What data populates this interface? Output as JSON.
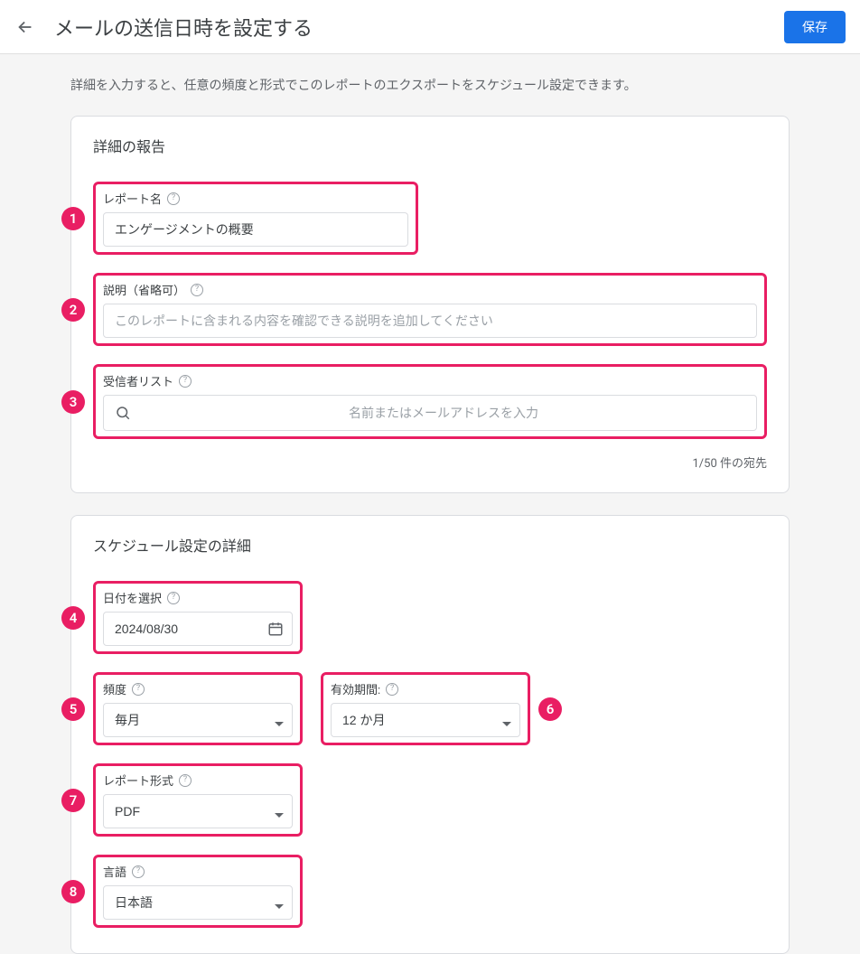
{
  "header": {
    "title": "メールの送信日時を設定する",
    "save_label": "保存"
  },
  "description": "詳細を入力すると、任意の頻度と形式でこのレポートのエクスポートをスケジュール設定できます。",
  "report_details": {
    "card_title": "詳細の報告",
    "name_label": "レポート名",
    "name_value": "エンゲージメントの概要",
    "desc_label": "説明（省略可）",
    "desc_placeholder": "このレポートに含まれる内容を確認できる説明を追加してください",
    "recipients_label": "受信者リスト",
    "recipients_placeholder": "名前またはメールアドレスを入力",
    "recipient_count": "1/50 件の宛先"
  },
  "schedule": {
    "card_title": "スケジュール設定の詳細",
    "date_label": "日付を選択",
    "date_value": "2024/08/30",
    "freq_label": "頻度",
    "freq_value": "毎月",
    "valid_label": "有効期間:",
    "valid_value": "12 か月",
    "format_label": "レポート形式",
    "format_value": "PDF",
    "lang_label": "言語",
    "lang_value": "日本語"
  },
  "badges": [
    "1",
    "2",
    "3",
    "4",
    "5",
    "6",
    "7",
    "8"
  ]
}
